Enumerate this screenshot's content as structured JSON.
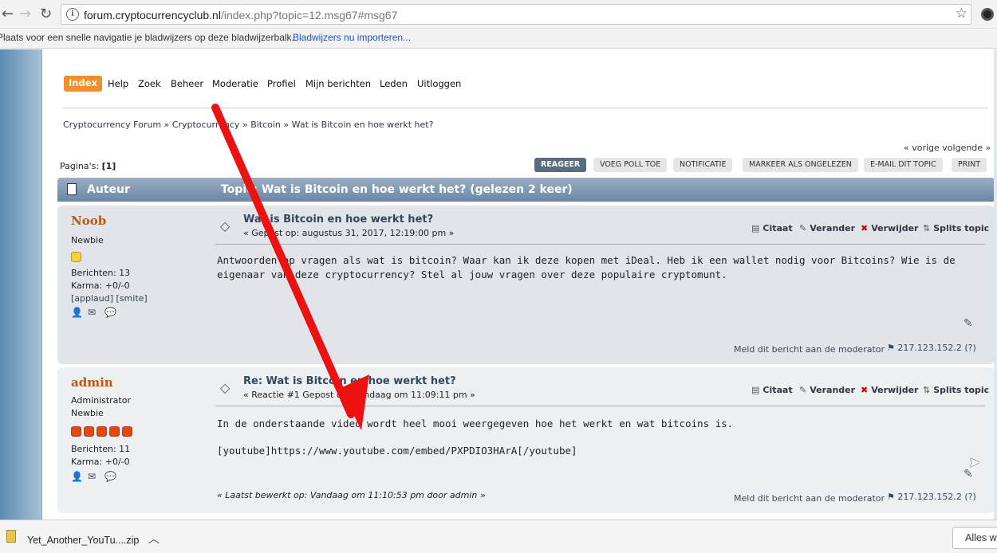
{
  "browser": {
    "url_host": "forum.cryptocurrencyclub.nl",
    "url_rest": "/index.php?topic=12.msg67#msg67",
    "bookmarks_text": "Plaats voor een snelle navigatie je bladwijzers op deze bladwijzerbalk.",
    "bookmarks_link": "Bladwijzers nu importeren..."
  },
  "menu": {
    "items": [
      "Index",
      "Help",
      "Zoek",
      "Beheer",
      "Moderatie",
      "Profiel",
      "Mijn berichten",
      "Leden",
      "Uitloggen"
    ]
  },
  "breadcrumb": [
    "Cryptocurrency Forum",
    "Cryptocurrency",
    "Bitcoin",
    "Wat is Bitcoin en hoe werkt het?"
  ],
  "page_index": "« vorige volgende »",
  "pages_label": "Pagina's:",
  "pages_current": "[1]",
  "buttons": [
    "REAGEER",
    "VOEG POLL TOE",
    "NOTIFICATIE",
    "MARKEER ALS ONGELEZEN",
    "E-MAIL DIT TOPIC",
    "PRINT"
  ],
  "category_bar": {
    "author": "Auteur",
    "topic": "Topic: Wat is Bitcoin en hoe werkt het?  (gelezen 2 keer)"
  },
  "quick_buttons": [
    "Citaat",
    "Verander",
    "Verwijder",
    "Splits topic"
  ],
  "posts": [
    {
      "name": "Noob",
      "group": "Newbie",
      "group2": "",
      "posts_count": "Berichten: 13",
      "karma": "Karma: +0/-0",
      "karma_links": "[applaud] [smite]",
      "subject": "Wat is Bitcoin en hoe werkt het?",
      "posted": "« Gepost op: augustus 31, 2017, 12:19:00 pm »",
      "body": "Antwoorden op vragen als wat is bitcoin? Waar kan ik deze kopen met iDeal. Heb ik een wallet nodig voor Bitcoins? Wie is de eigenaar van deze cryptocurrency? Stel al jouw vragen over deze populaire cryptomunt.",
      "report": "Meld dit bericht aan de moderator",
      "ip": "217.123.152.2 (?)"
    },
    {
      "name": "admin",
      "group": "Administrator",
      "group2": "Newbie",
      "posts_count": "Berichten: 11",
      "karma": "Karma: +0/-0",
      "subject": "Re: Wat is Bitcoin en hoe werkt het?",
      "posted": "« Reactie #1 Gepost op: Vandaag om 11:09:11 pm »",
      "body": "In de onderstaande video wordt heel mooi weergegeven hoe het werkt en wat bitcoins is.",
      "body2": "[youtube]https://www.youtube.com/embed/PXPDIO3HArA[/youtube]",
      "last_edit": "« Laatst bewerkt op: Vandaag om 11:10:53 pm door admin »",
      "report": "Meld dit bericht aan de moderator",
      "ip": "217.123.152.2 (?)"
    }
  ],
  "download": {
    "filename": "Yet_Another_YouTu....zip",
    "show_all": "Alles w"
  },
  "colors": {
    "accent_orange": "#f0902b",
    "poster_name": "#c0540a",
    "arrow_red": "#ee1111",
    "category_bar": "#7f97b3"
  }
}
